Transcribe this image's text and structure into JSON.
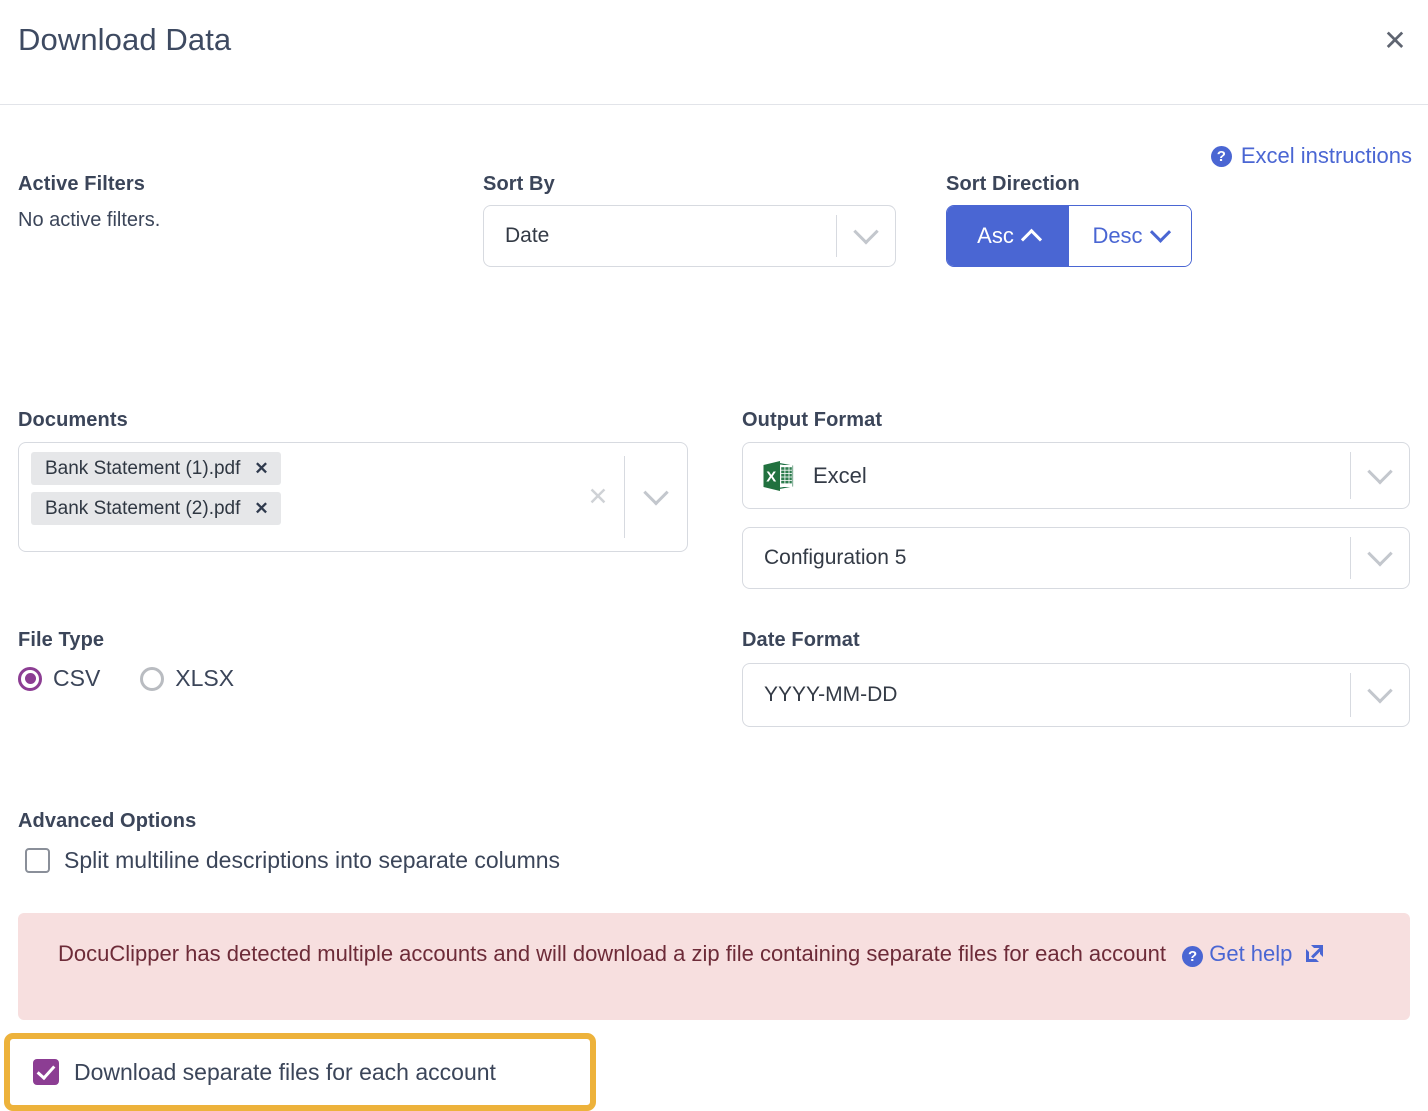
{
  "header": {
    "title": "Download Data",
    "close_label": "✕"
  },
  "help": {
    "excel_instructions_label": "Excel instructions",
    "help_glyph": "?"
  },
  "filters": {
    "label": "Active Filters",
    "value": "No active filters."
  },
  "sort_by": {
    "label": "Sort By",
    "value": "Date"
  },
  "sort_direction": {
    "label": "Sort Direction",
    "asc_label": "Asc",
    "desc_label": "Desc",
    "selected": "Asc"
  },
  "documents": {
    "label": "Documents",
    "chips": [
      {
        "name": "Bank Statement (1).pdf",
        "remove_label": "✕"
      },
      {
        "name": "Bank Statement (2).pdf",
        "remove_label": "✕"
      }
    ],
    "clear_label": "✕"
  },
  "output_format": {
    "label": "Output Format",
    "value": "Excel",
    "icon": "excel-icon",
    "configuration_value": "Configuration 5"
  },
  "file_type": {
    "label": "File Type",
    "options": [
      {
        "label": "CSV",
        "selected": true
      },
      {
        "label": "XLSX",
        "selected": false
      }
    ],
    "accent_color": "#8c3d93"
  },
  "date_format": {
    "label": "Date Format",
    "value": "YYYY-MM-DD"
  },
  "advanced_options": {
    "label": "Advanced Options",
    "split_multiline_label": "Split multiline descriptions into separate columns",
    "split_multiline_checked": false
  },
  "alert": {
    "text_before_link": "DocuClipper has detected multiple accounts and will download a zip file containing separate files for each account",
    "help_glyph": "?",
    "get_help_label": "Get help",
    "background_color": "#f7dfdf",
    "text_color": "#6d2b38"
  },
  "separate_files": {
    "label": "Download separate files for each account",
    "checked": true,
    "highlight_color": "#edb23b",
    "checkbox_color": "#8c3d93"
  }
}
